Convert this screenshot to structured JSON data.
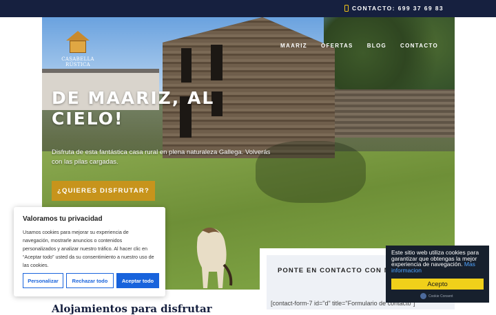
{
  "topbar": {
    "contact_text": "CONTACTO: 699 37 69 83",
    "icon": "phone-icon"
  },
  "logo": {
    "text": "CASABELLA RÚSTICA"
  },
  "nav": {
    "items": [
      {
        "label": "MAARIZ"
      },
      {
        "label": "OFERTAS"
      },
      {
        "label": "BLOG"
      },
      {
        "label": "CONTACTO"
      }
    ]
  },
  "hero": {
    "title": "DE MAARIZ, AL CIELO!",
    "subtitle": "Disfruta de esta fantástica casa rural en plena naturaleza Gallega. Volverás con las pilas cargadas.",
    "cta_label": "¿QUIERES DISFRUTAR?"
  },
  "contact_card": {
    "title": "PONTE EN CONTACTO CON NOSOTROS",
    "shortcode": "[contact-form-7 id=\"d\" title=\"Formulario de contacto\"]"
  },
  "section": {
    "heading": "Alojamientos para disfrutar"
  },
  "cookie_notice": {
    "title": "Valoramos tu privacidad",
    "body": "Usamos cookies para mejorar su experiencia de navegación, mostrarle anuncios o contenidos personalizados y analizar nuestro tráfico. Al hacer clic en “Aceptar todo” usted da su consentimiento a nuestro uso de las cookies.",
    "buttons": {
      "customize": "Personalizar",
      "reject": "Rechazar todo",
      "accept": "Aceptar todo"
    }
  },
  "cookie_banner": {
    "text": "Este sitio web utiliza cookies para garantizar que obtengas la mejor experiencia de navegación.",
    "link": "Mas informacion",
    "accept": "Acepto",
    "powered": "Cookie Consent"
  },
  "colors": {
    "topbar": "#16203f",
    "accent": "#c7941c",
    "cookie_blue": "#1863dc",
    "banner_yellow": "#f0d01a"
  }
}
